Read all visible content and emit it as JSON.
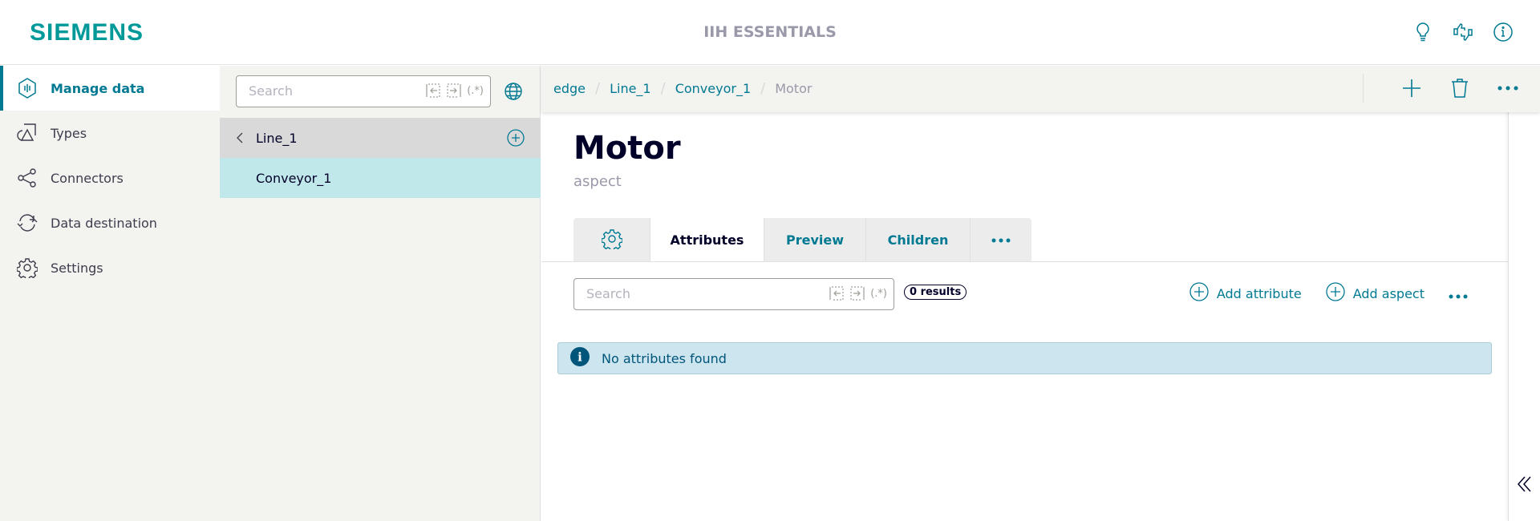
{
  "header": {
    "logo": "SIEMENS",
    "app_title": "IIH ESSENTIALS",
    "icons": [
      "lightbulb-icon",
      "feedback-thumbs-icon",
      "info-icon"
    ]
  },
  "sidebar": {
    "items": [
      {
        "label": "Manage data",
        "icon": "manage-data-icon",
        "active": true
      },
      {
        "label": "Types",
        "icon": "types-icon",
        "active": false
      },
      {
        "label": "Connectors",
        "icon": "connectors-share-icon",
        "active": false
      },
      {
        "label": "Data destination",
        "icon": "refresh-icon",
        "active": false
      },
      {
        "label": "Settings",
        "icon": "gear-icon",
        "active": false
      }
    ]
  },
  "tree": {
    "search_placeholder": "Search",
    "search_tools": [
      "←",
      "→",
      "(.*)"
    ],
    "parent": "Line_1",
    "children": [
      "Conveyor_1"
    ]
  },
  "breadcrumb": [
    "edge",
    "Line_1",
    "Conveyor_1",
    "Motor"
  ],
  "asset": {
    "title": "Motor",
    "subtitle": "aspect"
  },
  "tabs": [
    {
      "label": "",
      "icon": "gear-icon",
      "active": false
    },
    {
      "label": "Attributes",
      "active": true
    },
    {
      "label": "Preview",
      "active": false
    },
    {
      "label": "Children",
      "active": false
    },
    {
      "label": "•••",
      "active": false
    }
  ],
  "attributes": {
    "search_placeholder": "Search",
    "results": "0 results",
    "add_attribute": "Add attribute",
    "add_aspect": "Add aspect",
    "more": "•••",
    "empty_message": "No attributes found"
  },
  "colors": {
    "accent": "#007993",
    "brand": "#009999",
    "selected": "#c0e7e9",
    "info": "#cce5ef"
  }
}
